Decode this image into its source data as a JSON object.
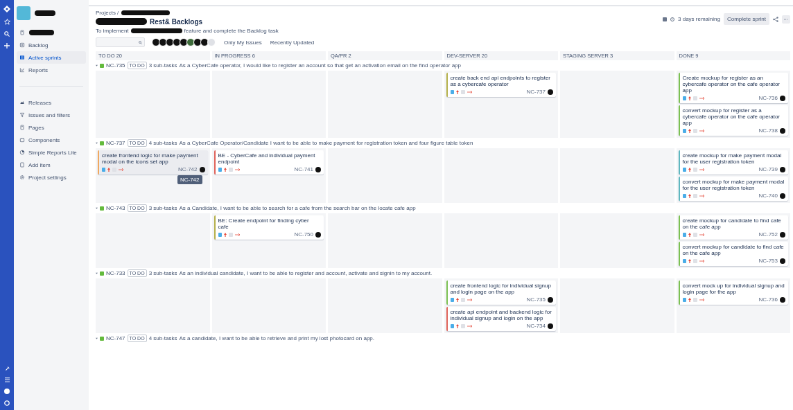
{
  "sidebar": {
    "items": [
      {
        "label": "Backlog",
        "selected": false
      },
      {
        "label": "Active sprints",
        "selected": true
      },
      {
        "label": "Reports",
        "selected": false
      },
      {
        "label": "Releases",
        "selected": false
      },
      {
        "label": "Issues and filters",
        "selected": false
      },
      {
        "label": "Pages",
        "selected": false
      },
      {
        "label": "Components",
        "selected": false
      },
      {
        "label": "Simple Reports Lite",
        "selected": false
      },
      {
        "label": "Add item",
        "selected": false
      },
      {
        "label": "Project settings",
        "selected": false
      }
    ]
  },
  "header": {
    "breadcrumb": "Projects /",
    "title": "Rest& Backlogs",
    "subtitle_start": "To implement",
    "subtitle_end": "feature and complete the Backlog task",
    "days_remaining": "3 days remaining",
    "complete_button": "Complete sprint"
  },
  "filters": {
    "quick_filters": [
      "Only My Issues",
      "Recently Updated"
    ]
  },
  "columns": [
    "TO DO 20",
    "IN PROGRESS 6",
    "QA/PR 2",
    "DEV-SERVER 20",
    "STAGING SERVER 3",
    "DONE 9"
  ],
  "swimlanes": [
    {
      "key": "NC-735",
      "status": "TO DO",
      "subtasks": "3 sub-tasks",
      "summary": "As a CyberCafe operator, I would like to register an account so that get an activation email on the find operator app",
      "cards": [
        {
          "kind": "devserver",
          "summary": "create back end api endpoints to register as a cybercafe operator",
          "key": "NC-737",
          "color": "#b5b04a",
          "hovered": false
        },
        {
          "kind": "done",
          "summary": "Create mockup for register as an cybercafe operator on the cafe operator app",
          "key": "NC-736",
          "color": "#7cc152",
          "hovered": false
        },
        {
          "kind": "done",
          "summary": "convert mockup for register as a cybercafe operator on the cafe operator app",
          "key": "NC-738",
          "color": "#7cc152",
          "hovered": false
        }
      ]
    },
    {
      "key": "NC-737",
      "status": "TO DO",
      "subtasks": "4 sub-tasks",
      "summary": "As a CyberCafe Operator/Candidate I want to be able to make payment for registration token and four figure table token",
      "cards": [
        {
          "kind": "todo",
          "summary": "create frontend logic for make payment modal on the icons set app",
          "key": "NC-742",
          "color": "#f0a860",
          "hovered": true,
          "tooltip": "NC-742"
        },
        {
          "kind": "inprogress",
          "summary": "BE - CyberCafe and individual payment endpoint",
          "key": "NC-741",
          "color": "#e0635a",
          "hovered": false
        },
        {
          "kind": "done",
          "summary": "create mockup for make payment modal for the user registration token",
          "key": "NC-739",
          "color": "#5fb8c0",
          "hovered": false
        },
        {
          "kind": "done",
          "summary": "convert mockup for make payment modal for the user registration token",
          "key": "NC-740",
          "color": "#5fb8c0",
          "hovered": false
        }
      ]
    },
    {
      "key": "NC-743",
      "status": "TO DO",
      "subtasks": "3 sub-tasks",
      "summary": "As a Candidate, I want to be able to search for a cafe from the search bar on the locate cafe app",
      "cards": [
        {
          "kind": "inprogress",
          "summary": "BE: Create endpoint for finding cyber cafe",
          "key": "NC-750",
          "color": "#b5b04a",
          "hovered": false
        },
        {
          "kind": "done",
          "summary": "create mockup for candidate to find cafe on the cafe app",
          "key": "NC-752",
          "color": "#7cc152",
          "hovered": false
        },
        {
          "kind": "done",
          "summary": "convert mockup for candidate to find cafe on the cafe app",
          "key": "NC-753",
          "color": "#7cc152",
          "hovered": false
        }
      ]
    },
    {
      "key": "NC-733",
      "status": "TO DO",
      "subtasks": "3 sub-tasks",
      "summary": "As an individual candidate, I want to be able to register and account, activate and signin to my account.",
      "cards": [
        {
          "kind": "devserver",
          "summary": "create frontend logic for individual signup and login page on the app",
          "key": "NC-735",
          "color": "#7cc152",
          "hovered": false
        },
        {
          "kind": "devserver",
          "summary": "create api endpoint and backend logic for individual signup and login on the app",
          "key": "NC-734",
          "color": "#e0635a",
          "hovered": false
        },
        {
          "kind": "done",
          "summary": "convert mock up for individual signup and login page for the app",
          "key": "NC-736",
          "color": "#7cc152",
          "hovered": false
        }
      ]
    },
    {
      "key": "NC-747",
      "status": "TO DO",
      "subtasks": "4 sub-tasks",
      "summary": "As a candidate, I want to be able to retrieve and print my lost photocard on app."
    }
  ]
}
